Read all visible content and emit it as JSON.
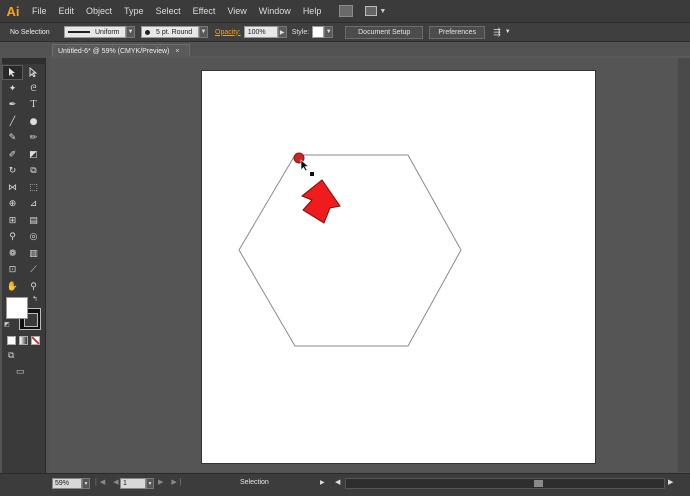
{
  "app": {
    "logo": "Ai"
  },
  "menu": [
    "File",
    "Edit",
    "Object",
    "Type",
    "Select",
    "Effect",
    "View",
    "Window",
    "Help"
  ],
  "control_bar": {
    "selection_label": "No Selection",
    "stroke_profile": "Uniform",
    "brush": "5 pt. Round",
    "opacity_label": "Opacity:",
    "opacity_value": "100%",
    "style_label": "Style:",
    "document_setup": "Document Setup",
    "preferences": "Preferences"
  },
  "document_tab": {
    "title": "Untitled-6* @ 59% (CMYK/Preview)",
    "close": "×"
  },
  "tools": {
    "rows": [
      [
        "selection-arrow",
        "direct-selection"
      ],
      [
        "magic-wand",
        "lasso"
      ],
      [
        "pen",
        "type"
      ],
      [
        "line-segment",
        "ellipse"
      ],
      [
        "paintbrush",
        "pencil"
      ],
      [
        "blob-brush",
        "eraser"
      ],
      [
        "rotate",
        "scale"
      ],
      [
        "width",
        "free-transform"
      ],
      [
        "shape-builder",
        "perspective-grid"
      ],
      [
        "mesh",
        "gradient"
      ],
      [
        "eyedropper",
        "blend"
      ],
      [
        "symbol-sprayer",
        "column-graph"
      ],
      [
        "artboard",
        "slice"
      ],
      [
        "hand",
        "zoom"
      ]
    ]
  },
  "colors": {
    "fill": "#ffffff",
    "stroke": "#111111",
    "cursor_highlight": "#c62828",
    "arrow": "#ee1c1c",
    "hexagon_stroke": "#8a8a8a"
  },
  "status_bar": {
    "zoom": "59%",
    "page": "1",
    "status": "Selection"
  }
}
